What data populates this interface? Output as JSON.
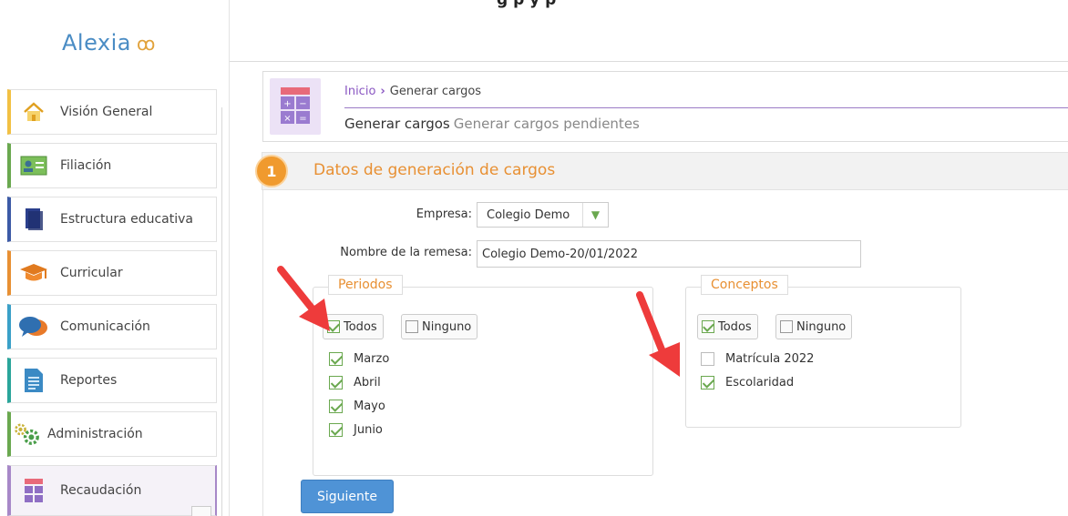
{
  "app": {
    "logo_text": "Alexia",
    "top_cut_text_left": "g",
    "top_cut_text_right": "g             p        y     p"
  },
  "sidebar": {
    "items": [
      {
        "label": "Visión General",
        "icon": "house-icon",
        "accent": "#f2c043"
      },
      {
        "label": "Filiación",
        "icon": "id-card-icon",
        "accent": "#6aa84f"
      },
      {
        "label": "Estructura educativa",
        "icon": "book-icon",
        "accent": "#3c5aa6"
      },
      {
        "label": "Curricular",
        "icon": "graduation-cap-icon",
        "accent": "#e89033"
      },
      {
        "label": "Comunicación",
        "icon": "chat-bubbles-icon",
        "accent": "#3aa0c8"
      },
      {
        "label": "Reportes",
        "icon": "document-icon",
        "accent": "#2aa59a"
      },
      {
        "label": "Administración",
        "icon": "gears-icon",
        "accent": "#6aa84f"
      },
      {
        "label": "Recaudación",
        "icon": "calculator-icon",
        "accent": "#a788c8"
      }
    ]
  },
  "header": {
    "breadcrumb_home": "Inicio",
    "breadcrumb_sep": "›",
    "breadcrumb_current": "Generar cargos",
    "title": "Generar cargos",
    "subtitle": "Generar cargos pendientes"
  },
  "step": {
    "number": "1",
    "title": "Datos de generación de cargos"
  },
  "form": {
    "empresa_label": "Empresa:",
    "empresa_value": "Colegio Demo",
    "remesa_label": "Nombre de la remesa:",
    "remesa_value": "Colegio Demo-20/01/2022"
  },
  "periodos": {
    "legend": "Periodos",
    "todos": "Todos",
    "ninguno": "Ninguno",
    "items": [
      {
        "label": "Marzo",
        "checked": true
      },
      {
        "label": "Abril",
        "checked": true
      },
      {
        "label": "Mayo",
        "checked": true
      },
      {
        "label": "Junio",
        "checked": true
      }
    ]
  },
  "conceptos": {
    "legend": "Conceptos",
    "todos": "Todos",
    "ninguno": "Ninguno",
    "items": [
      {
        "label": "Matrícula 2022",
        "checked": false
      },
      {
        "label": "Escolaridad",
        "checked": true
      }
    ]
  },
  "actions": {
    "next_label": "Siguiente"
  },
  "colors": {
    "accent_orange": "#e89033",
    "accent_purple": "#8a57c2",
    "primary_blue": "#4f93d6",
    "check_green": "#6aa84f",
    "arrow_red": "#ee3b3b"
  }
}
